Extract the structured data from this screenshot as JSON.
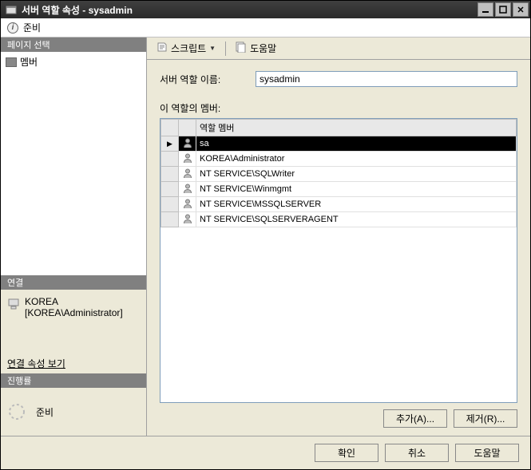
{
  "window": {
    "title": "서버 역할 속성 - sysadmin"
  },
  "subheader": {
    "label": "준비"
  },
  "sidebar": {
    "page_select_header": "페이지 선택",
    "page_items": [
      {
        "label": "멤버"
      }
    ],
    "connection_header": "연결",
    "connection": {
      "server": "KOREA",
      "user": "[KOREA\\Administrator]",
      "view_props": "연결 속성 보기"
    },
    "progress_header": "진행률",
    "progress_label": "준비"
  },
  "toolbar": {
    "script_label": "스크립트",
    "help_label": "도움말"
  },
  "main": {
    "role_name_label": "서버 역할 이름:",
    "role_name_value": "sysadmin",
    "members_label": "이 역할의 멤버:",
    "grid_header": "역할 멤버",
    "members": [
      {
        "name": "sa",
        "selected": true
      },
      {
        "name": "KOREA\\Administrator",
        "selected": false
      },
      {
        "name": "NT SERVICE\\SQLWriter",
        "selected": false
      },
      {
        "name": "NT SERVICE\\Winmgmt",
        "selected": false
      },
      {
        "name": "NT SERVICE\\MSSQLSERVER",
        "selected": false
      },
      {
        "name": "NT SERVICE\\SQLSERVERAGENT",
        "selected": false
      }
    ],
    "add_label": "추가(A)...",
    "remove_label": "제거(R)..."
  },
  "footer": {
    "ok": "확인",
    "cancel": "취소",
    "help": "도움말"
  }
}
